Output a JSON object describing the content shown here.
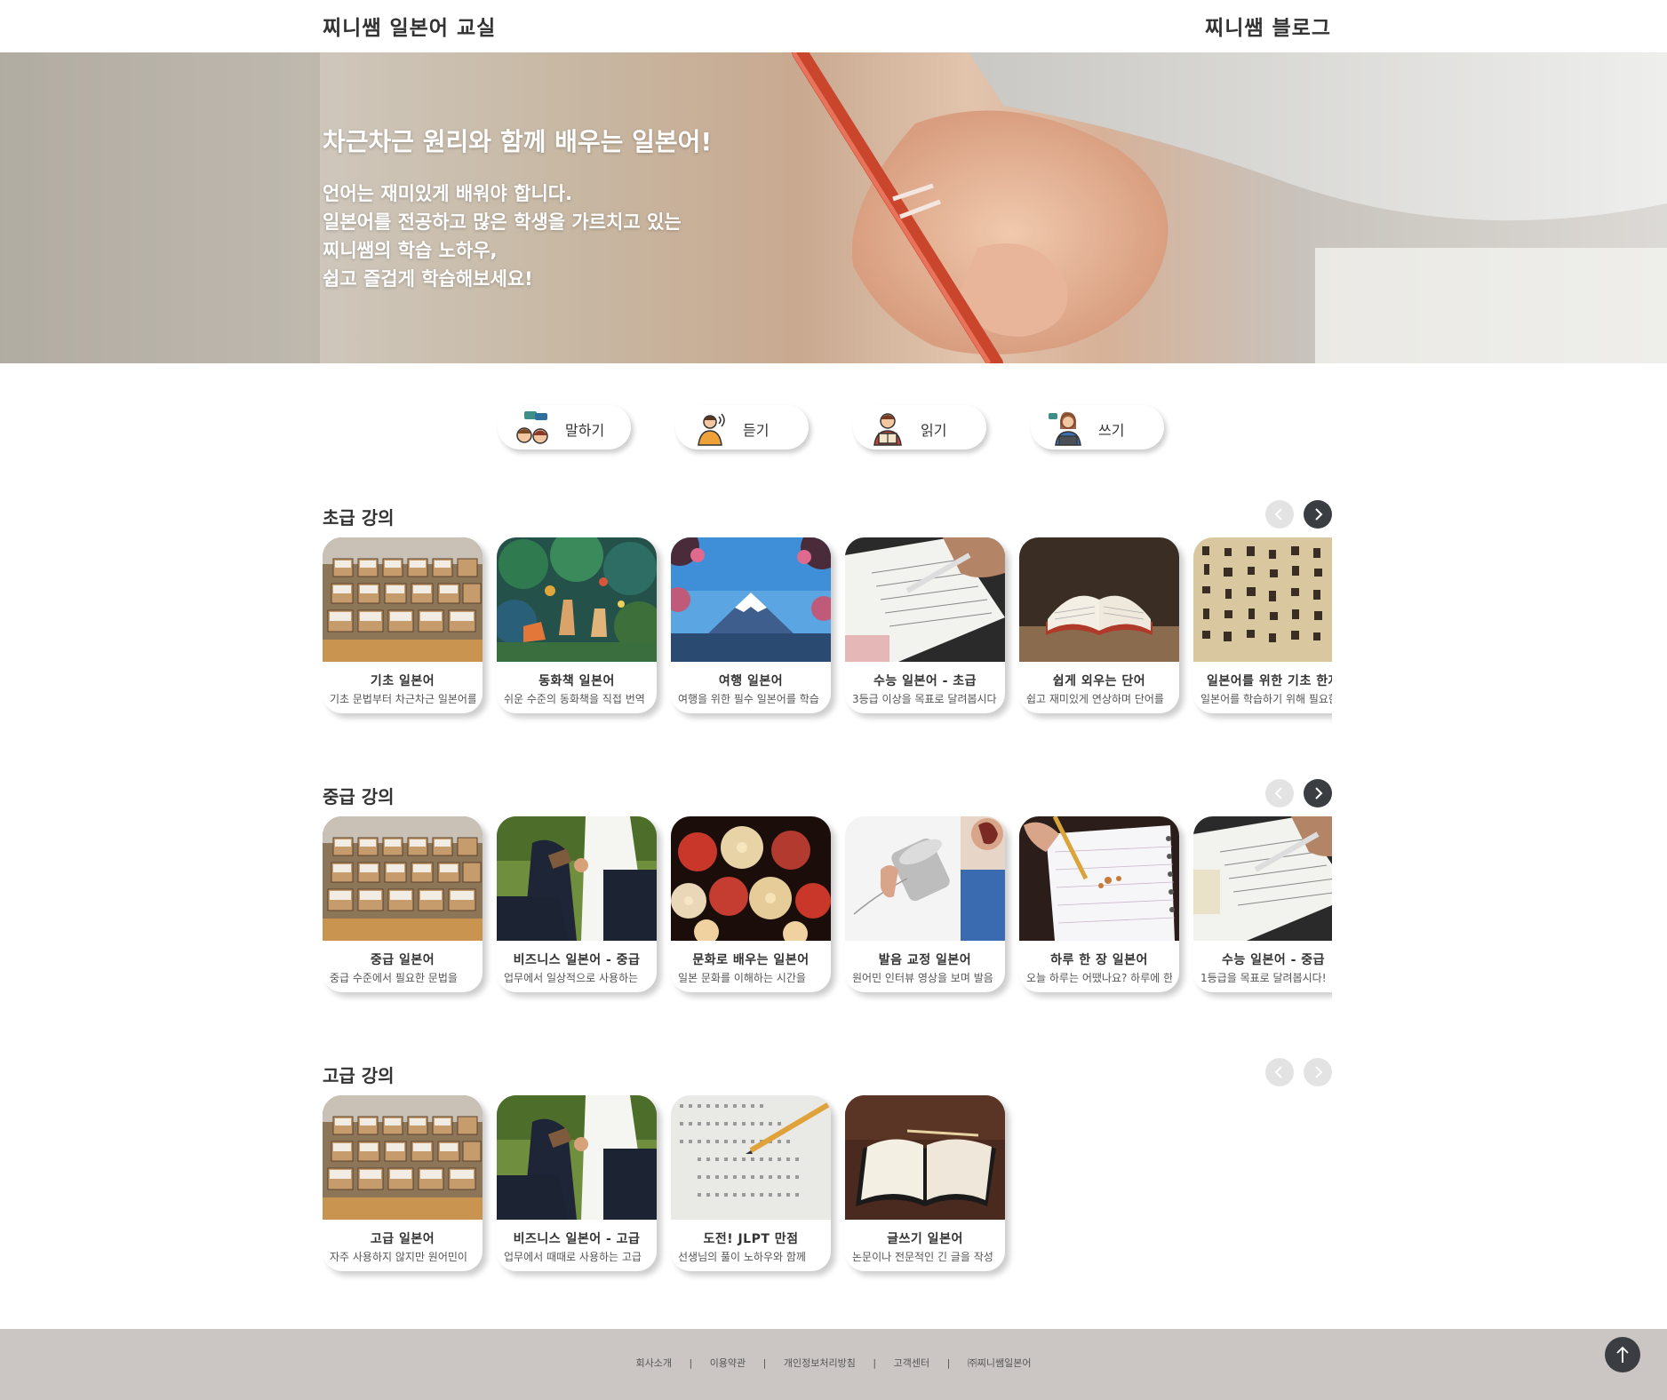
{
  "header": {
    "site_title": "찌니쌤 일본어 교실",
    "blog_link": "찌니쌤 블로그"
  },
  "hero": {
    "headline": "차근차근 원리와 함께 배우는 일본어!",
    "lines": [
      "언어는 재미있게 배워야 합니다.",
      "일본어를 전공하고 많은 학생을 가르치고 있는",
      "찌니쌤의 학습 노하우,",
      "쉽고 즐겁게 학습해보세요!"
    ]
  },
  "skills": [
    {
      "label": "말하기",
      "icon": "speech-bubbles-icon"
    },
    {
      "label": "듣기",
      "icon": "listening-person-icon"
    },
    {
      "label": "읽기",
      "icon": "reading-person-icon"
    },
    {
      "label": "쓰기",
      "icon": "laptop-person-icon"
    }
  ],
  "sections": [
    {
      "title": "초급 강의",
      "courses": [
        {
          "title": "기초 일본어",
          "desc": "기초 문법부터 차근차근 일본어를"
        },
        {
          "title": "동화책 일본어",
          "desc": "쉬운 수준의 동화책을 직접 번역"
        },
        {
          "title": "여행 일본어",
          "desc": "여행을 위한 필수 일본어를 학습"
        },
        {
          "title": "수능 일본어 - 초급",
          "desc": "3등급 이상을 목표로 달려봅시다"
        },
        {
          "title": "쉽게 외우는 단어",
          "desc": "쉽고 재미있게 연상하며 단어를"
        },
        {
          "title": "일본어를 위한 기초 한자",
          "desc": "일본어를 학습하기 위해 필요한"
        }
      ]
    },
    {
      "title": "중급 강의",
      "courses": [
        {
          "title": "중급 일본어",
          "desc": "중급 수준에서 필요한 문법을"
        },
        {
          "title": "비즈니스 일본어 - 중급",
          "desc": "업무에서 일상적으로 사용하는"
        },
        {
          "title": "문화로 배우는 일본어",
          "desc": "일본 문화를 이해하는 시간을"
        },
        {
          "title": "발음 교정 일본어",
          "desc": "원어민 인터뷰 영상을 보며 발음"
        },
        {
          "title": "하루 한 장 일본어",
          "desc": "오늘 하루는 어땠나요? 하루에 한"
        },
        {
          "title": "수능 일본어 - 중급",
          "desc": "1등급을 목표로 달려봅시다!"
        }
      ]
    },
    {
      "title": "고급 강의",
      "courses": [
        {
          "title": "고급 일본어",
          "desc": "자주 사용하지 않지만 원어민이"
        },
        {
          "title": "비즈니스 일본어 - 고급",
          "desc": "업무에서 때때로 사용하는 고급"
        },
        {
          "title": "도전! JLPT 만점",
          "desc": "선생님의 풀이 노하우와 함께"
        },
        {
          "title": "글쓰기 일본어",
          "desc": "논문이나 전문적인 긴 글을 작성"
        }
      ]
    }
  ],
  "footer": {
    "links": [
      "회사소개",
      "이용약관",
      "개인정보처리방침",
      "고객센터",
      "㈜찌니쌤일본어"
    ],
    "separator": "|"
  }
}
